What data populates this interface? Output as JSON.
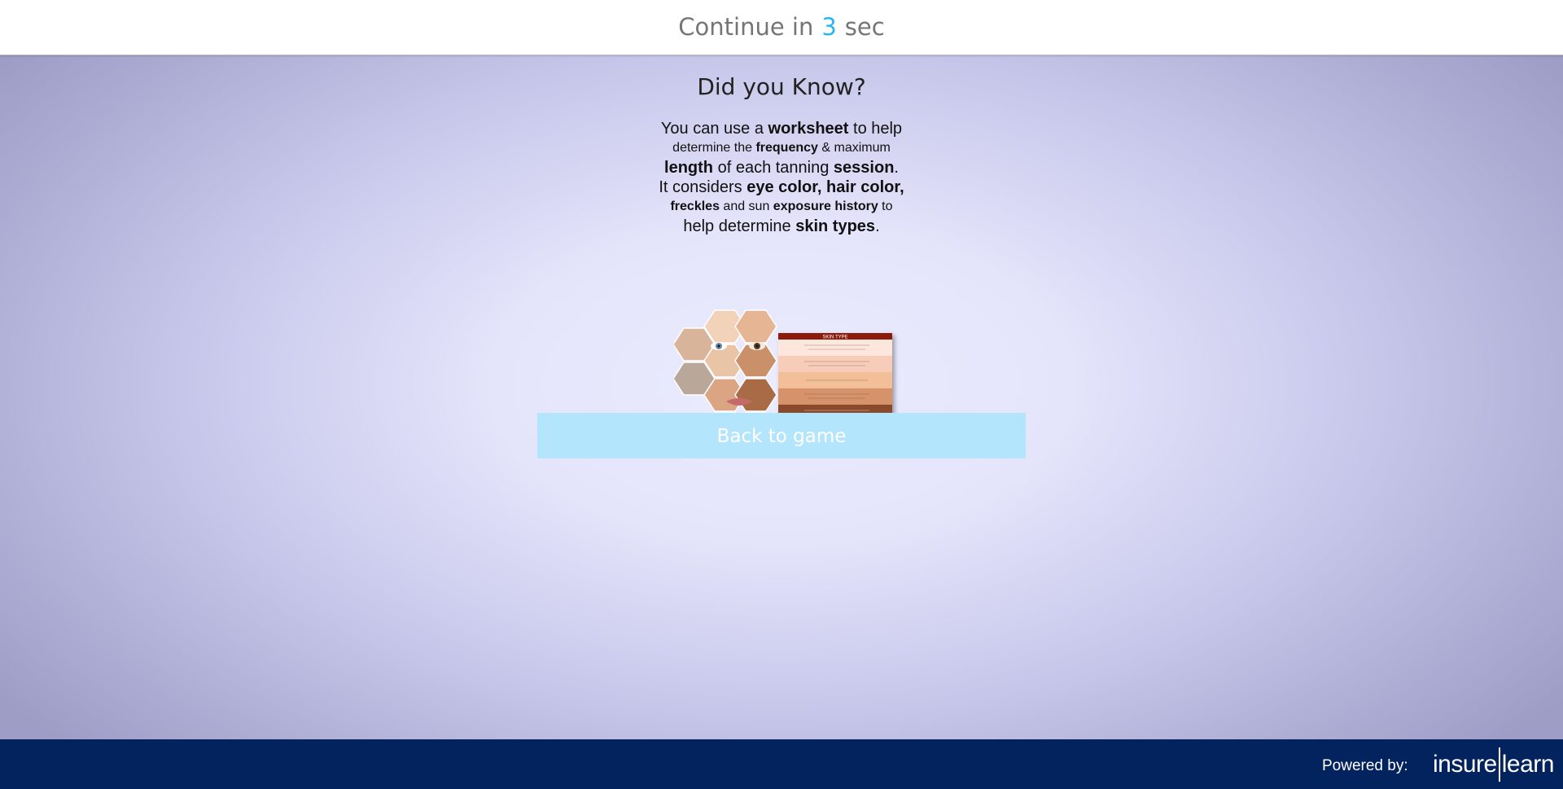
{
  "topbar": {
    "continue_label": "Continue in",
    "seconds": "3",
    "unit": "sec",
    "seconds_color": "#29b6f6"
  },
  "main": {
    "heading": "Did you Know?",
    "info": {
      "l1a": "You can use a ",
      "l1b": "worksheet",
      "l1c": " to help",
      "l2a": "determine the ",
      "l2b": "frequency",
      "l2c": " & maximum",
      "l3a": "length",
      "l3b": " of each tanning ",
      "l3c": "session",
      "l3d": ".",
      "l4a": "It considers ",
      "l4b": "eye color, hair color,",
      "l5a": "freckles",
      "l5b": " and sun ",
      "l5c": "exposure history",
      "l5d": " to",
      "l6a": "help determine ",
      "l6b": "skin types",
      "l6c": "."
    },
    "chart_header": "SKIN TYPE",
    "back_button": "Back to game",
    "button_color": "#b3e5fc"
  },
  "footer": {
    "powered_label": "Powered by:",
    "logo_left": "insure",
    "logo_right": "learn",
    "background": "#03235e"
  }
}
